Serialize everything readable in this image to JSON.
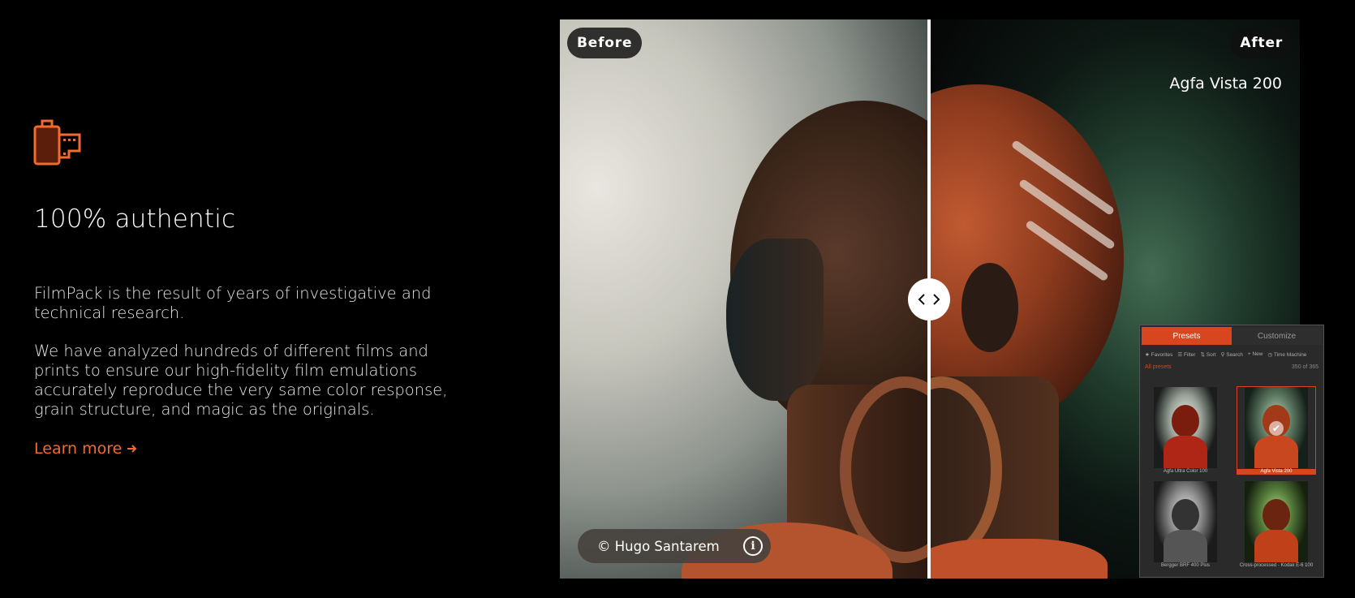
{
  "feature": {
    "heading": "100% authentic",
    "paragraph1": "FilmPack is the result of years of investigative and technical research.",
    "paragraph2": "We have analyzed hundreds of different films and prints to ensure our high-fidelity film emulations accurately reproduce the very same color response, grain structure, and magic as the originals.",
    "learn_more": "Learn more",
    "icon": "film-canister-icon",
    "accent_color": "#f26a2e"
  },
  "viewer": {
    "before_label": "Before",
    "after_label": "After",
    "preset_name": "Agfa Vista 200",
    "credit": "© Hugo Santarem",
    "info_glyph": "i",
    "slider_position": 0.5
  },
  "presets_panel": {
    "tabs": [
      {
        "label": "Presets",
        "active": true
      },
      {
        "label": "Customize",
        "active": false
      }
    ],
    "tools": [
      "Favorites",
      "Filter",
      "Sort",
      "Search",
      "New",
      "Time Machine"
    ],
    "section_label": "All presets",
    "count": "350 of 365",
    "thumbnails": [
      {
        "caption": "Agfa Ultra Color 100",
        "selected": false
      },
      {
        "caption": "Agfa Vista 200",
        "selected": true
      },
      {
        "caption": "Bergger BRF 400 Plus",
        "selected": false
      },
      {
        "caption": "Cross-processed - Kodak E-6 100",
        "selected": false
      }
    ],
    "accent_color": "#d8461f"
  }
}
